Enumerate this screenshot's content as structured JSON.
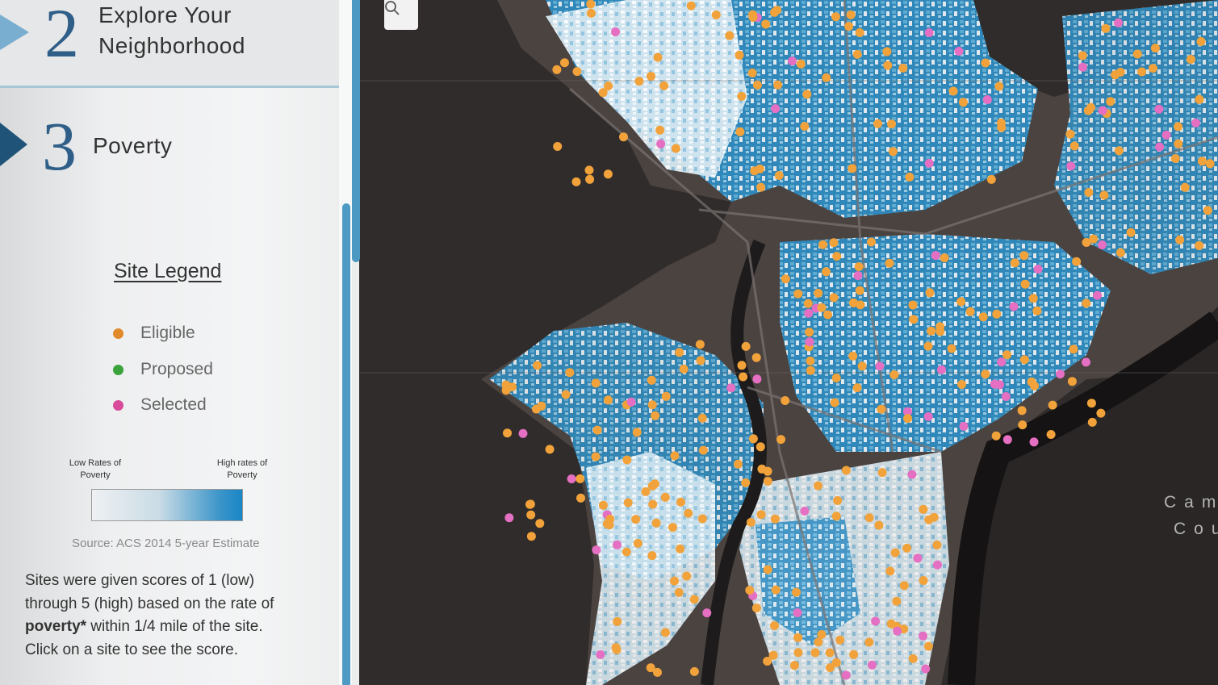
{
  "steps": [
    {
      "number": "2",
      "title_line1": "Explore Your",
      "title_line2": "Neighborhood"
    },
    {
      "number": "3",
      "title": "Poverty"
    }
  ],
  "legend": {
    "title": "Site Legend",
    "items": [
      {
        "label": "Eligible",
        "color": "#e08a2c"
      },
      {
        "label": "Proposed",
        "color": "#3aa33b"
      },
      {
        "label": "Selected",
        "color": "#d84a9a"
      }
    ]
  },
  "scale": {
    "low_line1": "Low Rates of",
    "low_line2": "Poverty",
    "high_line1": "High rates of",
    "high_line2": "Poverty",
    "color_low": "#eef1f3",
    "color_high": "#1a86c6"
  },
  "source": "Source: ACS 2014 5-year Estimate",
  "description": {
    "line1": "Sites were given scores of 1 (low)",
    "line2": "through 5 (high) based on the rate of",
    "line3_bold": "poverty*",
    "line3_rest": " within 1/4 mile of the site.",
    "line4": "Click on a site to see the score."
  },
  "map": {
    "search_icon": "search-icon",
    "label_line1": "Cam",
    "label_line2": "Cou",
    "colors": {
      "background": "#2f2c2b",
      "river": "#1d1b1b",
      "tract_light": "#e6eef3",
      "tract_mid": "#8fc3df",
      "tract_dark": "#2b8fc4",
      "eligible": "#f2a23a",
      "selected": "#e56fc2"
    }
  }
}
